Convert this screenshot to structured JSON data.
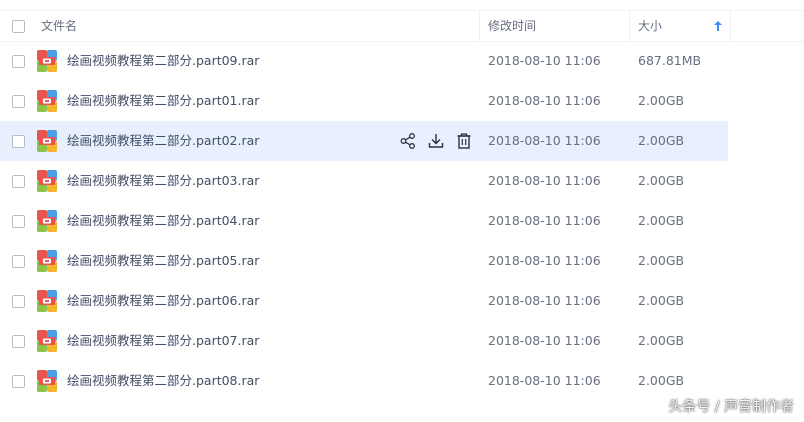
{
  "header": {
    "name_label": "文件名",
    "modified_label": "修改时间",
    "size_label": "大小"
  },
  "colors": {
    "hover_row": "#e8f0fd",
    "sort_arrow": "#3b8cff",
    "text": "#424e67",
    "muted_text": "#666e80"
  },
  "files": [
    {
      "name": "绘画视频教程第二部分.part09.rar",
      "modified": "2018-08-10 11:06",
      "size": "687.81MB",
      "icon": "rar-archive-icon"
    },
    {
      "name": "绘画视频教程第二部分.part01.rar",
      "modified": "2018-08-10 11:06",
      "size": "2.00GB",
      "icon": "rar-archive-icon"
    },
    {
      "name": "绘画视频教程第二部分.part02.rar",
      "modified": "2018-08-10 11:06",
      "size": "2.00GB",
      "icon": "rar-archive-icon",
      "hovered": true
    },
    {
      "name": "绘画视频教程第二部分.part03.rar",
      "modified": "2018-08-10 11:06",
      "size": "2.00GB",
      "icon": "rar-archive-icon"
    },
    {
      "name": "绘画视频教程第二部分.part04.rar",
      "modified": "2018-08-10 11:06",
      "size": "2.00GB",
      "icon": "rar-archive-icon"
    },
    {
      "name": "绘画视频教程第二部分.part05.rar",
      "modified": "2018-08-10 11:06",
      "size": "2.00GB",
      "icon": "rar-archive-icon"
    },
    {
      "name": "绘画视频教程第二部分.part06.rar",
      "modified": "2018-08-10 11:06",
      "size": "2.00GB",
      "icon": "rar-archive-icon"
    },
    {
      "name": "绘画视频教程第二部分.part07.rar",
      "modified": "2018-08-10 11:06",
      "size": "2.00GB",
      "icon": "rar-archive-icon"
    },
    {
      "name": "绘画视频教程第二部分.part08.rar",
      "modified": "2018-08-10 11:06",
      "size": "2.00GB",
      "icon": "rar-archive-icon"
    }
  ],
  "row_actions": [
    "share-icon",
    "download-icon",
    "delete-icon"
  ],
  "watermark": "头条号 / 声音制作者"
}
